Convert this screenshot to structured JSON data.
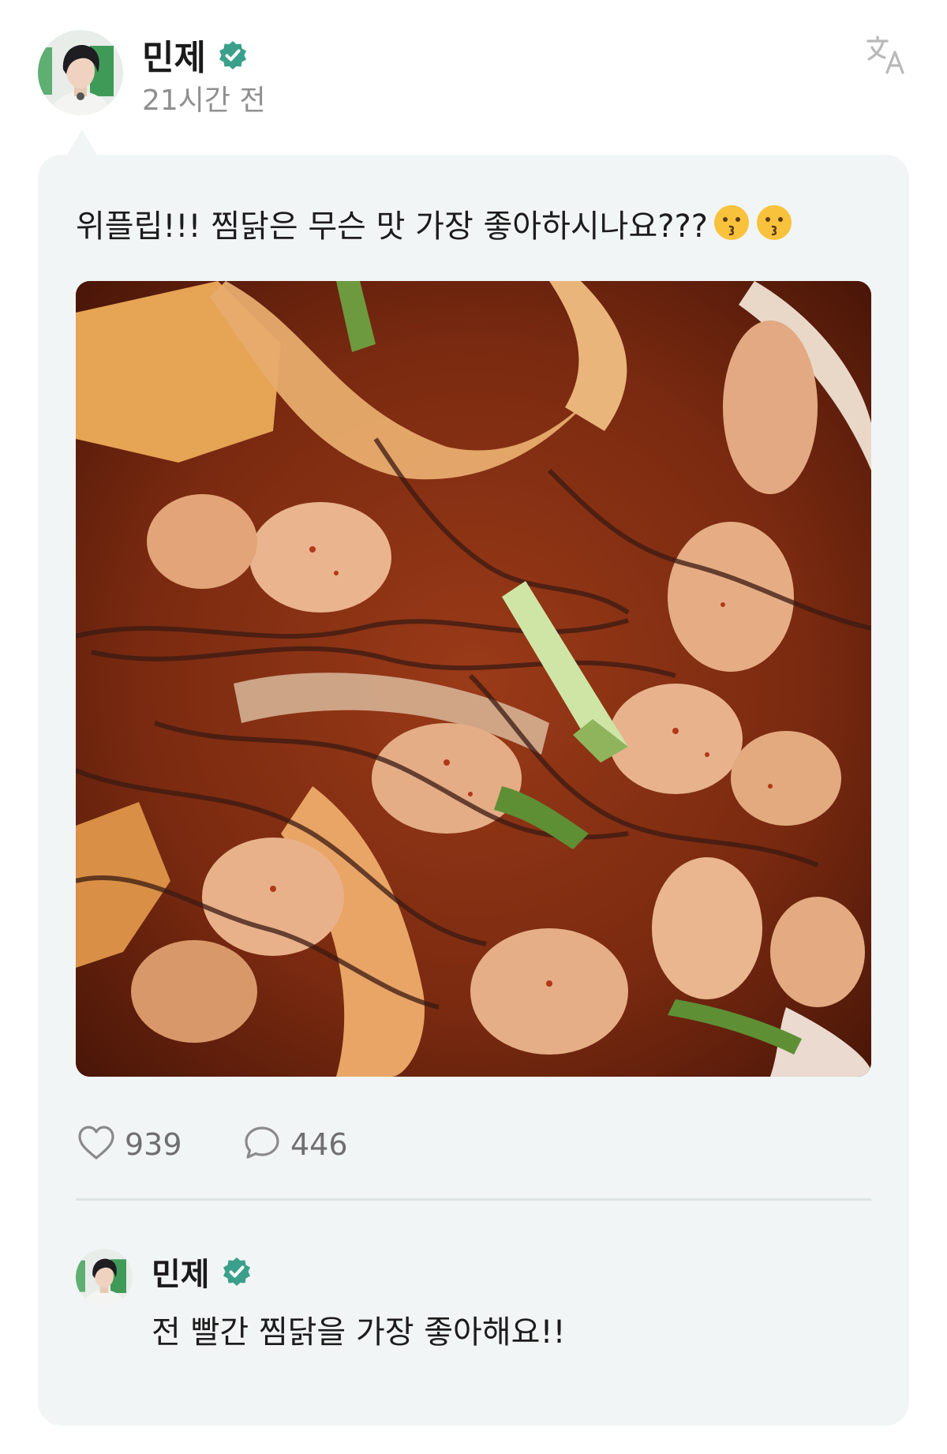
{
  "post": {
    "author": "민제",
    "timestamp": "21시간 전",
    "text": "위플립!!! 찜닭은 무슨 맛 가장 좋아하시나요???",
    "emojis": [
      "kissing-face",
      "kissing-face"
    ],
    "image_alt": "spicy braised chicken (jjimdak) with glass noodles, potatoes, onion and green onion",
    "likes": "939",
    "comments": "446"
  },
  "reply": {
    "author": "민제",
    "text": "전 빨간 찜닭을 가장 좋아해요!!"
  },
  "icons": {
    "translate": "translate-icon",
    "verified": "verified-badge-icon",
    "like": "heart-outline-icon",
    "comment": "comment-bubble-icon"
  },
  "colors": {
    "verified": "#3aa08b",
    "card_background": "#f1f5f5",
    "muted_text": "#8f8f8f"
  }
}
